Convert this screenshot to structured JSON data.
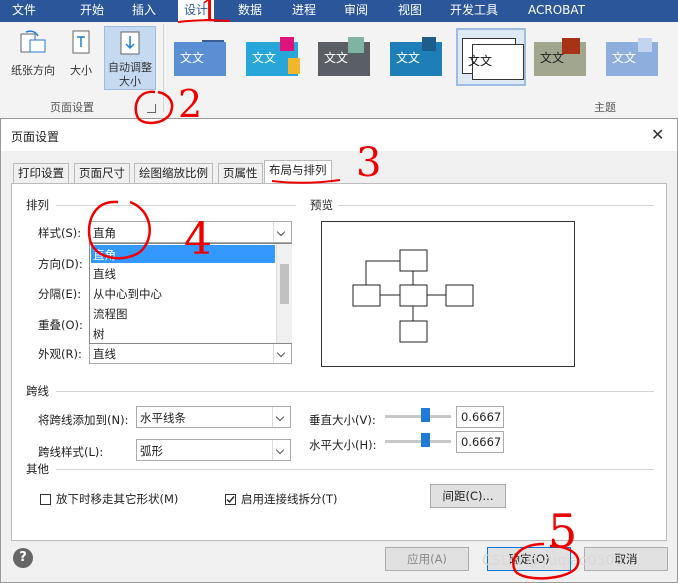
{
  "ribbon": {
    "tabs": [
      {
        "label": "文件"
      },
      {
        "label": "开始"
      },
      {
        "label": "插入"
      },
      {
        "label": "设计"
      },
      {
        "label": "数据"
      },
      {
        "label": "进程"
      },
      {
        "label": "审阅"
      },
      {
        "label": "视图"
      },
      {
        "label": "开发工具"
      },
      {
        "label": "ACROBAT"
      }
    ],
    "paper_orientation": "纸张方向",
    "size": "大小",
    "auto_size": "自动调整大小",
    "group_page_setup": "页面设置",
    "group_themes": "主题",
    "theme_text": "文文",
    "colors": {
      "tab_bar": "#2b579a",
      "accent": "#1e7bd7"
    }
  },
  "dialog": {
    "title": "页面设置",
    "tabs": [
      {
        "label": "打印设置"
      },
      {
        "label": "页面尺寸"
      },
      {
        "label": "绘图缩放比例"
      },
      {
        "label": "页属性"
      },
      {
        "label": "布局与排列"
      }
    ],
    "arrange": {
      "heading": "排列",
      "style_label": "样式(S):",
      "style_value": "直角",
      "direction_label": "方向(D):",
      "separation_label": "分隔(E):",
      "overlap_label": "重叠(O):",
      "appearance_label": "外观(R):",
      "appearance_value": "直线",
      "dropdown_options": [
        {
          "label": "直角"
        },
        {
          "label": "直线"
        },
        {
          "label": "从中心到中心"
        },
        {
          "label": "流程图"
        },
        {
          "label": "树"
        }
      ]
    },
    "preview_heading": "预览",
    "line_jumps": {
      "heading": "跨线",
      "add_to_label": "将跨线添加到(N):",
      "add_to_value": "水平线条",
      "style_label": "跨线样式(L):",
      "style_value": "弧形",
      "vertical_size_label": "垂直大小(V):",
      "vertical_size_value": "0.6667",
      "horizontal_size_label": "水平大小(H):",
      "horizontal_size_value": "0.6667"
    },
    "other": {
      "heading": "其他",
      "move_shapes_label": "放下时移走其它形状(M)",
      "move_shapes_checked": false,
      "split_connectors_label": "启用连接线拆分(T)",
      "split_connectors_checked": true,
      "spacing_button": "间距(C)..."
    },
    "buttons": {
      "apply": "应用(A)",
      "ok": "确定(O)",
      "cancel": "取消"
    }
  },
  "annotations": [
    {
      "text": "1"
    },
    {
      "text": "2"
    },
    {
      "text": "3"
    },
    {
      "text": "4"
    },
    {
      "text": "5"
    }
  ],
  "watermark": "CSDN @yuqiao0303"
}
